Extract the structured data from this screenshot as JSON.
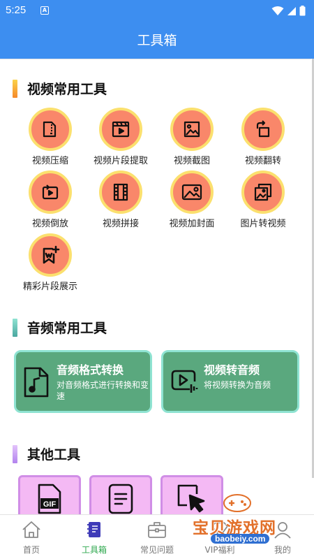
{
  "status_bar": {
    "time": "5:25",
    "sim_icon": "A"
  },
  "header": {
    "title": "工具箱"
  },
  "sections": {
    "video": {
      "title": "视频常用工具",
      "bar_color": "#f5a623"
    },
    "audio": {
      "title": "音频常用工具",
      "bar_color": "#5ec4a0"
    },
    "other": {
      "title": "其他工具",
      "bar_color": "#c79cf0"
    }
  },
  "video_tools": [
    {
      "label": "视频压缩",
      "icon": "compress-icon"
    },
    {
      "label": "视频片段提取",
      "icon": "video-clip-icon"
    },
    {
      "label": "视频截图",
      "icon": "screenshot-icon"
    },
    {
      "label": "视频翻转",
      "icon": "rotate-icon"
    },
    {
      "label": "视频倒放",
      "icon": "reverse-icon"
    },
    {
      "label": "视频拼接",
      "icon": "film-icon"
    },
    {
      "label": "视频加封面",
      "icon": "image-icon"
    },
    {
      "label": "图片转视频",
      "icon": "photos-icon"
    },
    {
      "label": "精彩片段展示",
      "icon": "highlight-icon"
    }
  ],
  "audio_tools": [
    {
      "title": "音频格式转换",
      "desc": "对音频格式进行转换和变速",
      "icon": "music-file-icon"
    },
    {
      "title": "视频转音频",
      "desc": "将视频转换为音频",
      "icon": "video-audio-icon"
    }
  ],
  "other_tools": [
    {
      "icon": "gif-file-icon",
      "label": "GIF"
    },
    {
      "icon": "document-icon"
    },
    {
      "icon": "crop-cursor-icon"
    }
  ],
  "tabs": [
    {
      "label": "首页",
      "icon": "home-icon",
      "active": false
    },
    {
      "label": "工具箱",
      "icon": "toolbox-icon",
      "active": true
    },
    {
      "label": "常见问题",
      "icon": "briefcase-icon",
      "active": false
    },
    {
      "label": "VIP福利",
      "icon": "vip-icon",
      "active": false
    },
    {
      "label": "我的",
      "icon": "profile-icon",
      "active": false
    }
  ],
  "watermark": {
    "text": "宝贝游戏网",
    "url": "baobeiy.com"
  },
  "colors": {
    "primary": "#3d8ef0",
    "tool_circle": "#f9876a",
    "tool_ring": "#fbe06e",
    "audio_card": "#5aa87e",
    "other_tile": "#f4b9f4",
    "tab_active": "#2fa84f"
  }
}
